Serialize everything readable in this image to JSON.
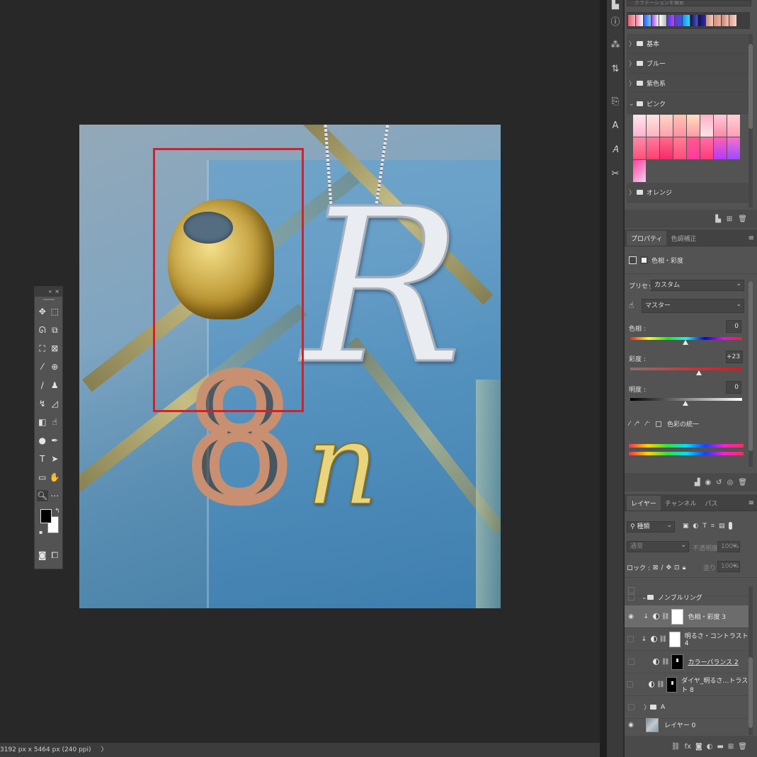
{
  "status_bar": {
    "doc_size": "3192 px x 5464 px (240 ppi)",
    "arrow": "〉"
  },
  "tools_panel": {
    "header_collapse": "«",
    "header_close": "×"
  },
  "gradients_panel": {
    "search_placeholder": "グラデーションを検索",
    "folders": [
      {
        "label": "基本",
        "expanded": false
      },
      {
        "label": "ブルー",
        "expanded": false
      },
      {
        "label": "紫色系",
        "expanded": false
      },
      {
        "label": "ピンク",
        "expanded": true
      },
      {
        "label": "オレンジ",
        "expanded": false
      }
    ]
  },
  "properties_panel": {
    "tabs": [
      "プロパティ",
      "色調補正"
    ],
    "adjustment_title": "色相・彩度",
    "preset_label": "プリセット :",
    "preset_value": "カスタム",
    "channel_value": "マスター",
    "hue_label": "色相 :",
    "hue_value": "0",
    "saturation_label": "彩度 :",
    "saturation_value": "+23",
    "lightness_label": "明度 :",
    "lightness_value": "0",
    "colorize_label": "色彩の統一"
  },
  "layers_panel": {
    "tabs": [
      "レイヤー",
      "チャンネル",
      "パス"
    ],
    "filter_kind": "種類",
    "blend_mode": "通常",
    "opacity_label": "不透明度 :",
    "opacity_value": "100%",
    "lock_label": "ロック :",
    "fill_label": "塗り :",
    "fill_value": "100%",
    "layers": [
      {
        "name": "ノンブルリング"
      },
      {
        "name": "色相・彩度 3"
      },
      {
        "name": "明るさ・コントラスト 4"
      },
      {
        "name": "カラーバランス 2"
      },
      {
        "name": "ダイヤ_明るさ…トラスト 8"
      },
      {
        "name": "A"
      },
      {
        "name": "レイヤー 0"
      }
    ]
  },
  "accent_colors": {
    "selection_rect": "#d4202a",
    "ui_bg": "#535353",
    "canvas_bg": "#282828"
  }
}
